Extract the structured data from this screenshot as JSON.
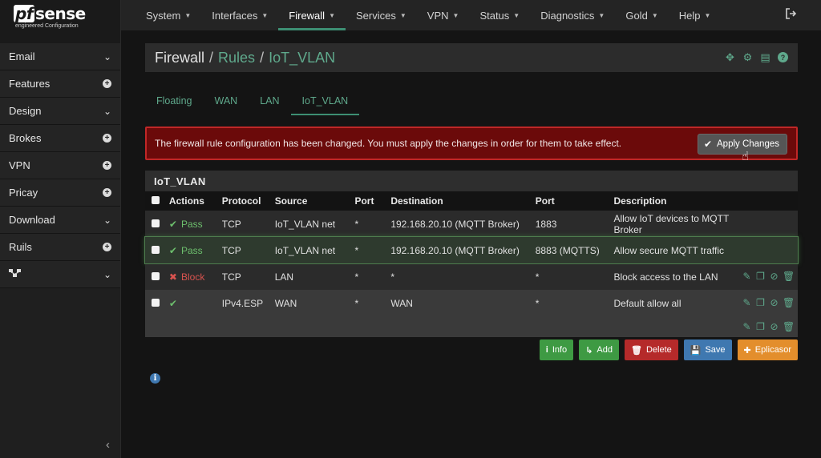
{
  "logo": {
    "pf": "pf",
    "main": "sense",
    "sub": "engineered Configuration"
  },
  "sidebar": {
    "items": [
      {
        "label": "Email",
        "indicator": "chevron"
      },
      {
        "label": "Features",
        "indicator": "plus"
      },
      {
        "label": "Design",
        "indicator": "chevron"
      },
      {
        "label": "Brokes",
        "indicator": "plus"
      },
      {
        "label": "VPN",
        "indicator": "plus"
      },
      {
        "label": "Pricay",
        "indicator": "plus"
      },
      {
        "label": "Download",
        "indicator": "chevron"
      },
      {
        "label": "Ruils",
        "indicator": "plus"
      },
      {
        "label": "",
        "indicator": "chevron",
        "icon": "network-icon"
      }
    ]
  },
  "nav": {
    "items": [
      "System",
      "Interfaces",
      "Firewall",
      "Services",
      "VPN",
      "Status",
      "Diagnostics",
      "Gold",
      "Help"
    ],
    "active": "Firewall"
  },
  "breadcrumb": {
    "root": "Firewall",
    "sep": "/",
    "link1": "Rules",
    "link2": "IoT_VLAN"
  },
  "tabs": {
    "items": [
      "Floating",
      "WAN",
      "LAN",
      "IoT_VLAN"
    ],
    "active": "IoT_VLAN"
  },
  "alert": {
    "message": "The firewall rule configuration has been changed. You must apply the changes in order for them to take effect.",
    "button": "Apply Changes"
  },
  "panel": {
    "title": "IoT_VLAN",
    "headers": [
      "Actions",
      "Protocol",
      "Source",
      "Port",
      "Destination",
      "Port",
      "Description"
    ],
    "rows": [
      {
        "action": "Pass",
        "protocol": "TCP",
        "source": "IoT_VLAN net",
        "sport": "*",
        "destination": "192.168.20.10 (MQTT Broker)",
        "dport": "1883",
        "description": "Allow IoT devices to MQTT Broker"
      },
      {
        "action": "Pass",
        "protocol": "TCP",
        "source": "IoT_VLAN net",
        "sport": "*",
        "destination": "192.168.20.10 (MQTT Broker)",
        "dport": "8883 (MQTTS)",
        "description": "Allow secure MQTT traffic"
      },
      {
        "action": "Block",
        "protocol": "TCP",
        "source": "LAN",
        "sport": "*",
        "destination": "*",
        "dport": "*",
        "description": "Block access to the LAN"
      },
      {
        "action": "",
        "protocol": "IPv4.ESP",
        "source": "WAN",
        "sport": "*",
        "destination": "WAN",
        "dport": "*",
        "description": "Default allow all"
      }
    ]
  },
  "buttons": {
    "info": "Info",
    "add": "Add",
    "delete": "Delete",
    "save": "Save",
    "epl": "Eplicasor"
  },
  "colors": {
    "accent": "#3d8f73",
    "link": "#5fa98c",
    "alert_bg": "#6b0a0a",
    "alert_border": "#c02727",
    "pass": "#6dbf6d",
    "block": "#d9534f"
  }
}
